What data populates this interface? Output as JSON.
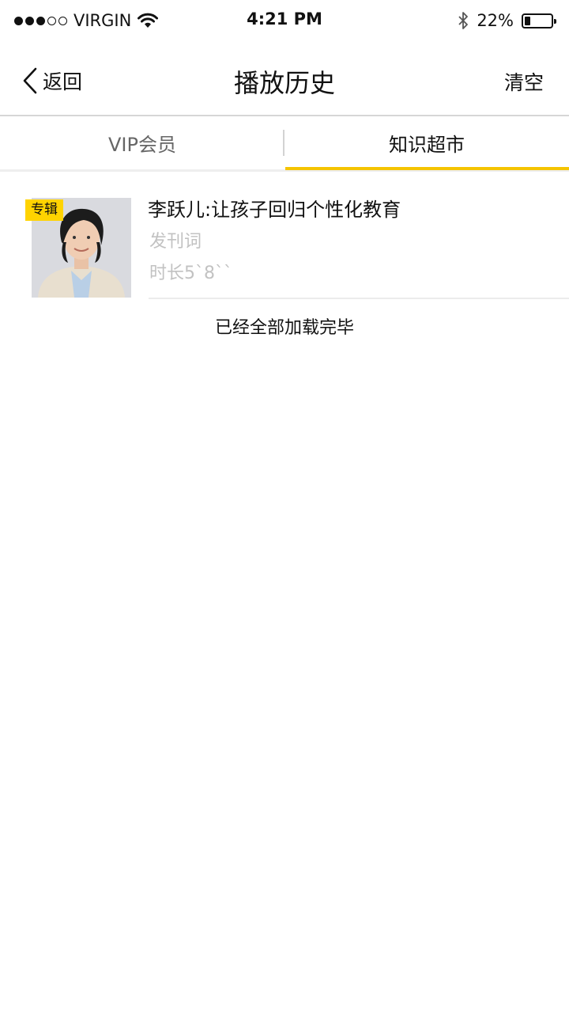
{
  "status_bar": {
    "carrier": "VIRGIN",
    "time": "4:21 PM",
    "battery_percent": "22%",
    "battery_level": 0.22,
    "signal_bars_filled": 3,
    "signal_bars_total": 5,
    "icons": [
      "wifi-icon",
      "bluetooth-icon",
      "battery-icon"
    ]
  },
  "nav": {
    "back_label": "返回",
    "title": "播放历史",
    "clear_label": "清空"
  },
  "tabs": [
    {
      "label": "VIP会员",
      "active": false
    },
    {
      "label": "知识超市",
      "active": true
    }
  ],
  "accent_color": "#f5c400",
  "history": [
    {
      "badge": "专辑",
      "title": "李跃儿:让孩子回归个性化教育",
      "subtitle": "发刊词",
      "duration": "时长5`8``"
    }
  ],
  "footer_note": "已经全部加载完毕"
}
